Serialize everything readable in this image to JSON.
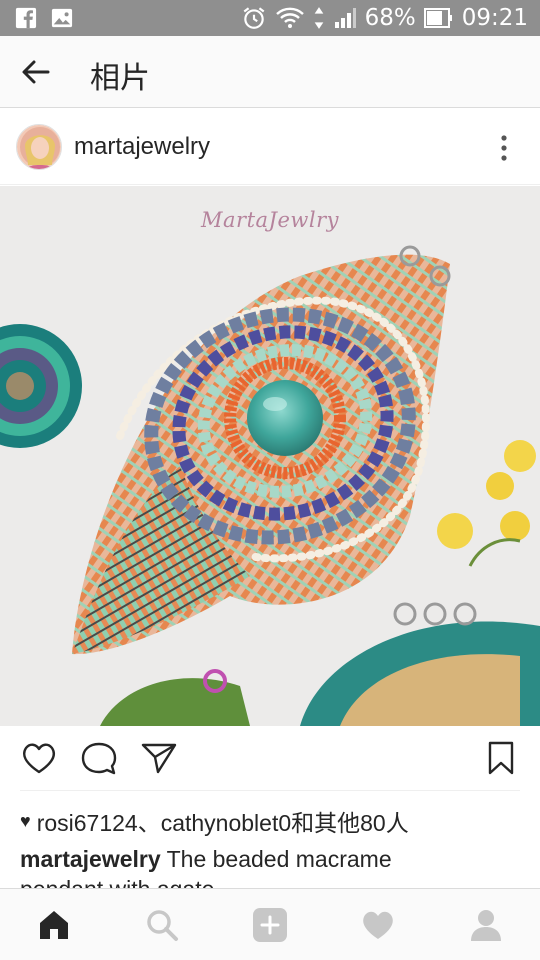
{
  "status_bar": {
    "battery_percent": "68%",
    "time": "09:21",
    "left_icons": [
      "facebook-icon",
      "gallery-icon"
    ],
    "right_icons": [
      "alarm-icon",
      "wifi-icon",
      "signal-icon",
      "battery-icon"
    ]
  },
  "app_bar": {
    "title": "相片"
  },
  "post": {
    "username": "martajewelry",
    "photo_watermark": "MartaJewlry",
    "likes_text": "rosi67124、cathynoblet0和其他80人",
    "caption_user": "martajewelry",
    "caption_text": " The beaded macrame",
    "caption_second_line": "pendant with agate..."
  },
  "actions": [
    "heart-icon",
    "comment-icon",
    "share-icon",
    "bookmark-icon"
  ],
  "bottom_nav": [
    "home-icon",
    "search-icon",
    "add-icon",
    "activity-icon",
    "profile-icon"
  ],
  "colors": {
    "status_bar": "#8f8f8f",
    "text": "#262626",
    "icon_gray": "#c7c7c7",
    "accent_pink": "#b5839c"
  }
}
